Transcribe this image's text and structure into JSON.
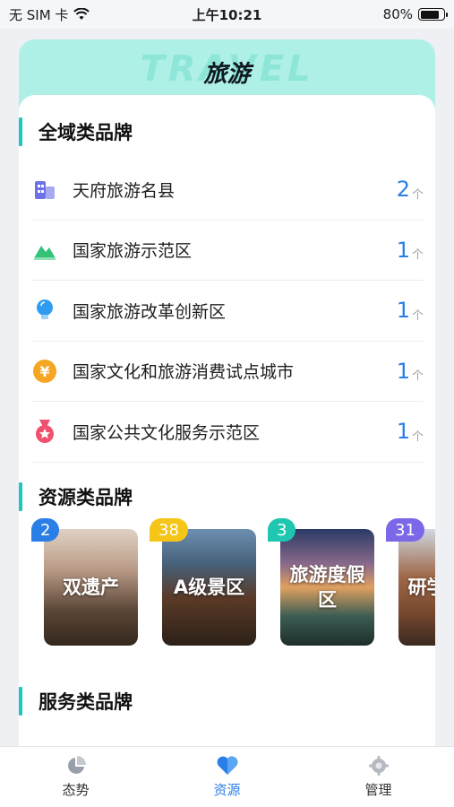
{
  "status_bar": {
    "carrier": "无 SIM 卡",
    "time": "上午10:21",
    "battery": "80%",
    "battery_level": 0.8
  },
  "hero": {
    "bg_text": "TRAVEL",
    "title": "旅游"
  },
  "sections": {
    "region": {
      "title": "全域类品牌"
    },
    "resource": {
      "title": "资源类品牌"
    },
    "service": {
      "title": "服务类品牌"
    }
  },
  "region_brands": [
    {
      "label": "天府旅游名县",
      "count": "2",
      "unit": "个",
      "icon": "building-icon",
      "color": "#7b7fe8"
    },
    {
      "label": "国家旅游示范区",
      "count": "1",
      "unit": "个",
      "icon": "mountain-icon",
      "color": "#3cc47c"
    },
    {
      "label": "国家旅游改革创新区",
      "count": "1",
      "unit": "个",
      "icon": "bulb-icon",
      "color": "#2e9cf0"
    },
    {
      "label": "国家文化和旅游消费试点城市",
      "count": "1",
      "unit": "个",
      "icon": "yen-icon",
      "color": "#f5a623"
    },
    {
      "label": "国家公共文化服务示范区",
      "count": "1",
      "unit": "个",
      "icon": "medal-icon",
      "color": "#f0506e"
    }
  ],
  "resource_cards": [
    {
      "label": "双遗产",
      "count": "2",
      "badge_color": "#2a7fe6"
    },
    {
      "label": "A级景区",
      "count": "38",
      "badge_color": "#f5c518"
    },
    {
      "label": "旅游度假区",
      "count": "3",
      "badge_color": "#1fc6b0"
    },
    {
      "label": "研学旅游",
      "count": "31",
      "badge_color": "#7b68e8"
    }
  ],
  "tabs": [
    {
      "label": "态势",
      "icon": "pie-chart-icon",
      "active": false
    },
    {
      "label": "资源",
      "icon": "heart-icon",
      "active": true
    },
    {
      "label": "管理",
      "icon": "gear-icon",
      "active": false
    }
  ]
}
